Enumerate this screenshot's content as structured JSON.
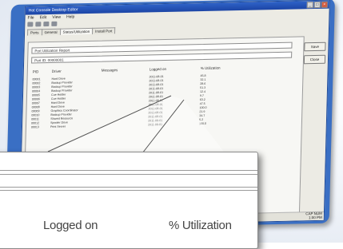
{
  "window": {
    "title": "Hot Console Desktop Editor",
    "controls": [
      "_",
      "□",
      "×"
    ]
  },
  "menu": [
    "File",
    "Edit",
    "View",
    "Help"
  ],
  "tabs": [
    "Ports",
    "General",
    "Status/Utilization",
    "Install Port"
  ],
  "fields": {
    "field1": "Port Utilization Report",
    "field2": "Port ID: 00000001"
  },
  "columns": [
    "PID",
    "Driver",
    "Messages",
    "Logged on",
    "% Utilization"
  ],
  "rows": [
    [
      "00001",
      "Hard Drive",
      "",
      "2011-08-01",
      "45.8"
    ],
    [
      "00002",
      "Backup Provider",
      "",
      "2011-08-01",
      "32.1"
    ],
    [
      "00003",
      "Backup Provider",
      "",
      "2011-08-01",
      "28.6"
    ],
    [
      "00004",
      "Backup Provider",
      "",
      "2011-08-01",
      "51.3"
    ],
    [
      "00005",
      "Cue Holder",
      "",
      "2011-08-01",
      "12.4"
    ],
    [
      "00006",
      "Cue Holder",
      "",
      "2011-08-01",
      "9.7"
    ],
    [
      "00007",
      "Hard Drive",
      "",
      "2011-08-01",
      "63.2"
    ],
    [
      "00008",
      "Hard Drive",
      "",
      "2011-08-01",
      "47.5"
    ],
    [
      "00009",
      "Graphics Coordinator",
      "",
      "2011-08-01",
      "100.0"
    ],
    [
      "00010",
      "Backup Provider",
      "",
      "2011-08-01",
      "21.9"
    ],
    [
      "00011",
      "Shared Resource",
      "",
      "2011-08-01",
      "34.7"
    ],
    [
      "00012",
      "Spooler Drive",
      "",
      "2011-08-01",
      "5.2"
    ],
    [
      "00013",
      "Print Server",
      "",
      "2011-08-01",
      "100.0"
    ]
  ],
  "buttons": {
    "save": "Save",
    "close": "Close"
  },
  "status": {
    "line1": "CAP NUM",
    "line2": "1:00 PM"
  },
  "magnified": {
    "col_logged": "Logged on",
    "col_util": "% Utilization"
  }
}
